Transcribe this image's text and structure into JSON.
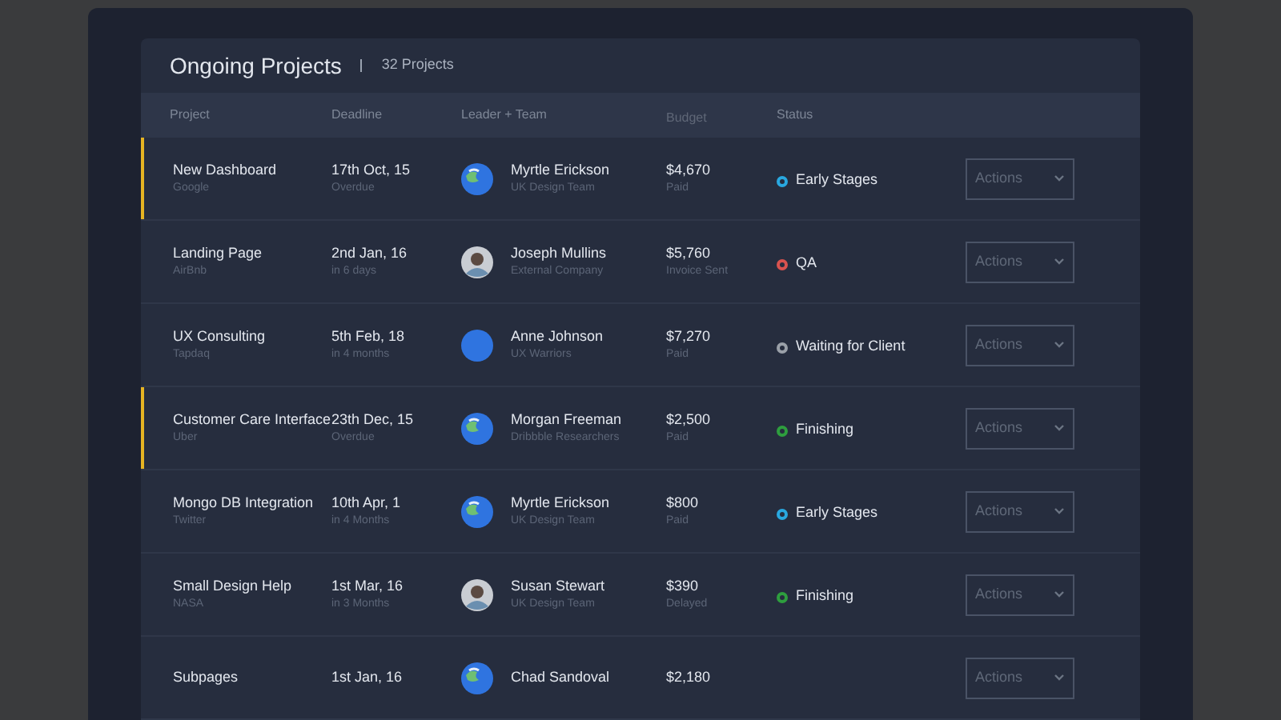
{
  "title": "Ongoing Projects",
  "count": "32 Projects",
  "columns": [
    "Project",
    "Deadline",
    "Leader + Team",
    "Budget",
    "Status"
  ],
  "rows": [
    {
      "highlighted": true,
      "project": "New Dashboard",
      "client": "Google",
      "deadline": "17th Oct, 15",
      "deadline_note": "Overdue",
      "avatar": {
        "kind": "globe"
      },
      "leader": "Myrtle Erickson",
      "team": "UK Design Team",
      "budget": "$4,670",
      "budget_note": "Paid",
      "status": "Early Stages",
      "color": "#29a8e0",
      "action": "Actions"
    },
    {
      "highlighted": false,
      "project": "Landing Page",
      "client": "AirBnb",
      "deadline": "2nd Jan, 16",
      "deadline_note": "in 6 days",
      "avatar": {
        "kind": "photo"
      },
      "leader": "Joseph Mullins",
      "team": "External Company",
      "budget": "$5,760",
      "budget_note": "Invoice Sent",
      "status": "QA",
      "color": "#d9534f",
      "action": "Actions"
    },
    {
      "highlighted": false,
      "project": "UX Consulting",
      "client": "Tapdaq",
      "deadline": "5th Feb, 18",
      "deadline_note": "in 4 months",
      "avatar": {
        "kind": "plain"
      },
      "leader": "Anne Johnson",
      "team": "UX Warriors",
      "budget": "$7,270",
      "budget_note": "Paid",
      "status": "Waiting for Client",
      "color": "#9aa0a8",
      "action": "Actions"
    },
    {
      "highlighted": true,
      "project": "Customer Care Interface",
      "client": "Uber",
      "deadline": "23th Dec, 15",
      "deadline_note": "Overdue",
      "avatar": {
        "kind": "globe"
      },
      "leader": "Morgan Freeman",
      "team": "Dribbble Researchers",
      "budget": "$2,500",
      "budget_note": "Paid",
      "status": "Finishing",
      "color": "#2e9e3e",
      "action": "Actions"
    },
    {
      "highlighted": false,
      "project": "Mongo DB Integration",
      "client": "Twitter",
      "deadline": "10th Apr, 1",
      "deadline_note": "in 4 Months",
      "avatar": {
        "kind": "globe"
      },
      "leader": "Myrtle Erickson",
      "team": "UK Design Team",
      "budget": "$800",
      "budget_note": "Paid",
      "status": "Early Stages",
      "color": "#29a8e0",
      "action": "Actions"
    },
    {
      "highlighted": false,
      "project": "Small Design Help",
      "client": "NASA",
      "deadline": "1st Mar, 16",
      "deadline_note": "in 3 Months",
      "avatar": {
        "kind": "photo"
      },
      "leader": "Susan Stewart",
      "team": "UK Design Team",
      "budget": "$390",
      "budget_note": "Delayed",
      "status": "Finishing",
      "color": "#2e9e3e",
      "action": "Actions"
    },
    {
      "highlighted": false,
      "project": "Subpages",
      "deadline": "1st Jan, 16",
      "avatar": {
        "kind": "globe"
      },
      "leader": "Chad Sandoval",
      "budget": "$2,180",
      "action": "Actions"
    }
  ]
}
